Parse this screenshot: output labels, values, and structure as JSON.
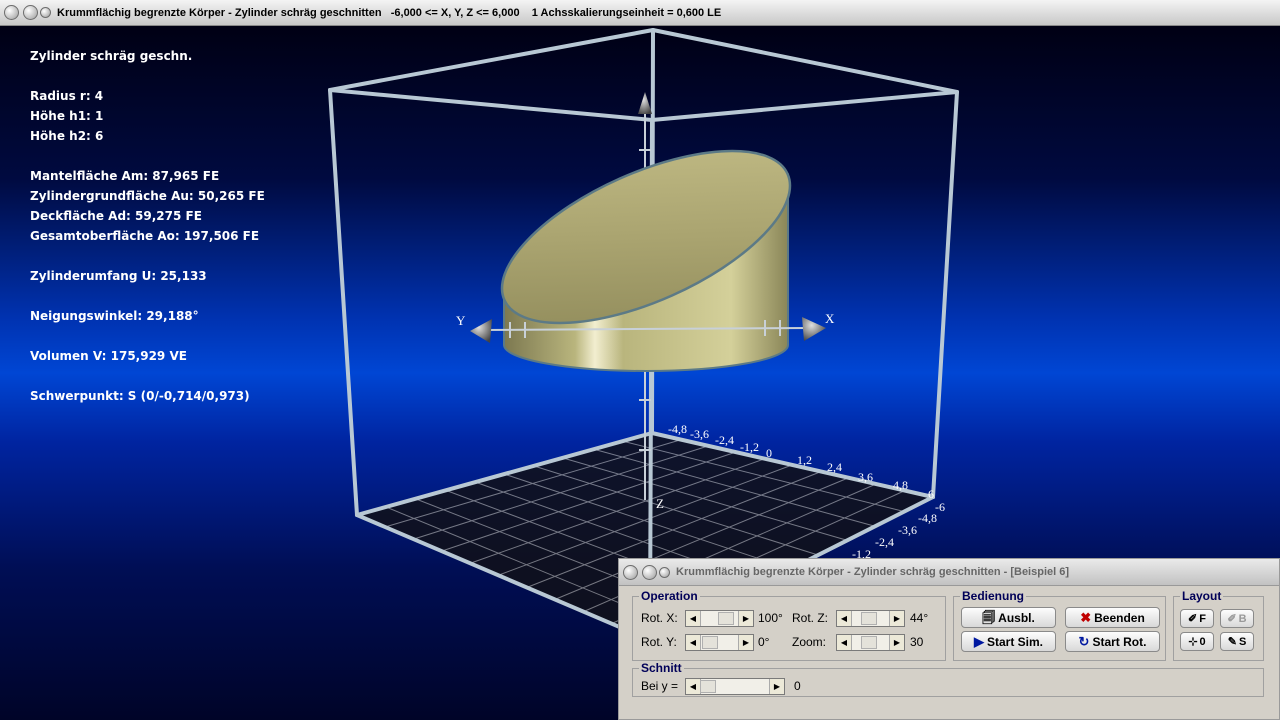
{
  "window": {
    "title": "Krummflächig begrenzte Körper - Zylinder schräg geschnitten   -6,000 <= X, Y, Z <= 6,000    1 Achsskalierungseinheit = 0,600 LE"
  },
  "info": {
    "lines": [
      "Zylinder schräg geschn.",
      "",
      "Radius r: 4",
      "Höhe h1: 1",
      "Höhe h2: 6",
      "",
      "Mantelfläche Am: 87,965 FE",
      "Zylindergrundfläche Au: 50,265 FE",
      "Deckfläche Ad: 59,275 FE",
      "Gesamtoberfläche Ao: 197,506 FE",
      "",
      "Zylinderumfang U: 25,133",
      "",
      "Neigungswinkel: 29,188°",
      "",
      "Volumen V: 175,929 VE",
      "",
      "Schwerpunkt: S (0/-0,714/0,973)"
    ]
  },
  "scene": {
    "axis_x_label": "X",
    "axis_y_label": "Y",
    "axis_z_label": "Z",
    "tick_labels_row": [
      "-4,8",
      "-3,6",
      "-2,4",
      "-1,2",
      "0",
      "1,2",
      "2,4",
      "3,6",
      "4,8",
      "6"
    ],
    "tick_labels_side": [
      "-6",
      "-4,8",
      "-3,6",
      "-2,4",
      "-1,2"
    ],
    "colors": {
      "cylinder_body": "#b9b57d",
      "cylinder_top": "#a8a26d",
      "frame": "#b8c8d4"
    }
  },
  "control": {
    "title": "Krummflächig begrenzte Körper - Zylinder schräg geschnitten - [Beispiel 6]",
    "operation": {
      "legend": "Operation",
      "rot_x_label": "Rot. X:",
      "rot_x_value": "100°",
      "rot_y_label": "Rot. Y:",
      "rot_y_value": "0°",
      "rot_z_label": "Rot. Z:",
      "rot_z_value": "44°",
      "zoom_label": "Zoom:",
      "zoom_value": "30"
    },
    "bedienung": {
      "legend": "Bedienung",
      "ausbl_label": "Ausbl.",
      "beenden_label": "Beenden",
      "start_sim_label": "Start Sim.",
      "start_rot_label": "Start Rot."
    },
    "layout": {
      "legend": "Layout",
      "btn_f_label": "F",
      "btn_b_label": "B",
      "btn_0_label": "0",
      "btn_s_label": "S"
    },
    "schnitt": {
      "legend": "Schnitt",
      "bei_y_label": "Bei y =",
      "bei_y_value": "0"
    }
  }
}
